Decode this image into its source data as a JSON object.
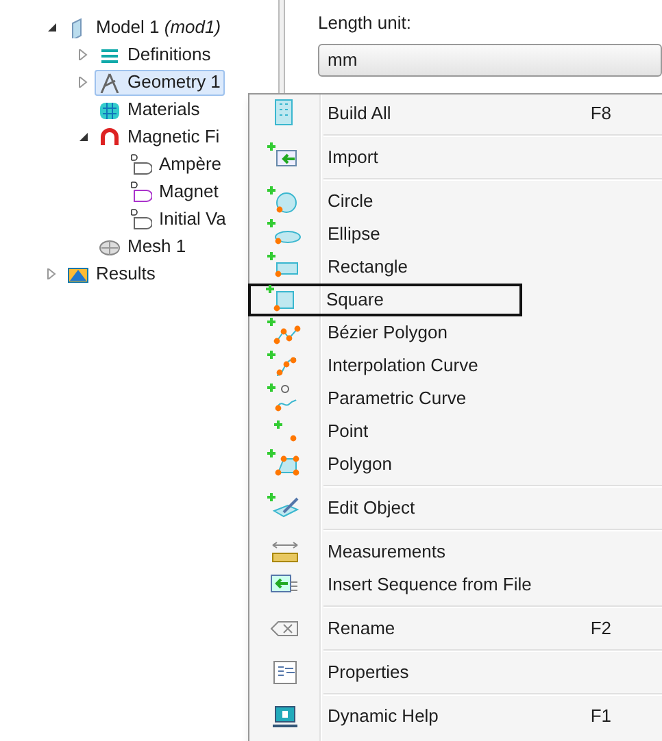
{
  "tree": [
    {
      "label": "Model 1 *(mod1)*",
      "expanded": true,
      "selected": false,
      "children": [
        {
          "label": "Definitions",
          "expanded": false,
          "selected": false
        },
        {
          "label": "Geometry 1",
          "expanded": false,
          "selected": true
        },
        {
          "label": "Materials",
          "selected": false
        },
        {
          "label": "Magnetic Fi",
          "expanded": true,
          "selected": false,
          "children": [
            {
              "label": "Ampère",
              "selected": false
            },
            {
              "label": "Magnet",
              "selected": false
            },
            {
              "label": "Initial Va",
              "selected": false
            }
          ]
        },
        {
          "label": "Mesh 1",
          "selected": false
        }
      ]
    },
    {
      "label": "Results",
      "expanded": false,
      "selected": false
    }
  ],
  "settings": {
    "label": "Length unit:",
    "unit": "mm"
  },
  "menu": [
    [
      {
        "label": "Build All",
        "shortcut": "F8",
        "focused": false
      }
    ],
    [
      {
        "label": "Import",
        "focused": false
      }
    ],
    [
      {
        "label": "Circle",
        "focused": false
      },
      {
        "label": "Ellipse",
        "focused": false
      },
      {
        "label": "Rectangle",
        "focused": false
      },
      {
        "label": "Square",
        "focused": true
      },
      {
        "label": "Bézier Polygon",
        "focused": false
      },
      {
        "label": "Interpolation Curve",
        "focused": false
      },
      {
        "label": "Parametric Curve",
        "focused": false
      },
      {
        "label": "Point",
        "focused": false
      },
      {
        "label": "Polygon",
        "focused": false
      }
    ],
    [
      {
        "label": "Edit Object",
        "focused": false
      }
    ],
    [
      {
        "label": "Measurements",
        "focused": false
      },
      {
        "label": "Insert Sequence from File",
        "focused": false
      }
    ],
    [
      {
        "label": "Rename",
        "shortcut": "F2",
        "focused": false
      }
    ],
    [
      {
        "label": "Properties",
        "focused": false
      }
    ],
    [
      {
        "label": "Dynamic Help",
        "shortcut": "F1",
        "focused": false
      }
    ]
  ]
}
